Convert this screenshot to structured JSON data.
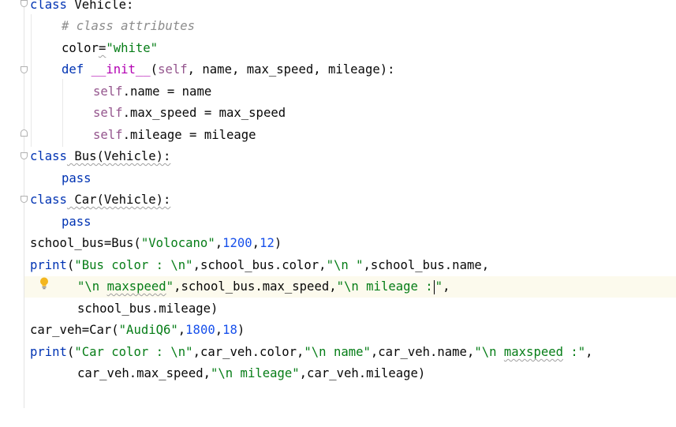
{
  "code": {
    "l1": {
      "kw": "class",
      "rest": " Vehicle:"
    },
    "l2": {
      "comment": "# class attributes"
    },
    "l3": {
      "name": "color",
      "eq": "=",
      "str": "\"white\""
    },
    "l4": {
      "kw": "def",
      "fn": "__init__",
      "open": "(",
      "self": "self",
      "params": ", name, max_speed, mileage",
      "close": "):"
    },
    "l5": {
      "self": "self",
      "rest": ".name = name"
    },
    "l6": {
      "self": "self",
      "rest": ".max_speed = max_speed"
    },
    "l7": {
      "self": "self",
      "rest": ".mileage = mileage"
    },
    "l8": {
      "kw": "class",
      "rest": " Bus(Vehicle):"
    },
    "l9": {
      "kw": "pass"
    },
    "l10": {
      "kw": "class",
      "rest": " Car(Vehicle):"
    },
    "l11": {
      "kw": "pass"
    },
    "l12": {
      "a": "school_bus=Bus(",
      "s1": "\"Volocano\"",
      "c1": ",",
      "n1": "1200",
      "c2": ",",
      "n2": "12",
      "end": ")"
    },
    "l13": {
      "fn": "print",
      "a": "(",
      "s1": "\"Bus color : \\n\"",
      "b": ",school_bus.color,",
      "s2": "\"\\n \"",
      "c": ",school_bus.name,"
    },
    "l14": {
      "s1a": "\"\\n ",
      "s1b": "maxspeed",
      "s1c": "\"",
      "b": ",school_bus.max_speed,",
      "s2a": "\"\\n mileage :",
      "s2b": "\"",
      "c": ","
    },
    "l15": {
      "a": "school_bus.mileage)"
    },
    "l16": {
      "a": "car_veh=Car(",
      "s1": "\"AudiQ6\"",
      "c1": ",",
      "n1": "1800",
      "c2": ",",
      "n2": "18",
      "end": ")"
    },
    "l17": {
      "fn": "print",
      "a": "(",
      "s1": "\"Car color : \\n\"",
      "b": ",car_veh.color,",
      "s2": "\"\\n name\"",
      "c": ",car_veh.name,",
      "s3a": "\"\\n ",
      "s3b": "maxspeed",
      "s3c": " :\"",
      "d": ","
    },
    "l18": {
      "a": "car_veh.max_speed,",
      "s1": "\"\\n mileage\"",
      "b": ",car_veh.mileage)"
    }
  },
  "icons": {
    "intention": "lightbulb-icon",
    "fold": "fold-marker-icon"
  },
  "colors": {
    "keyword": "#0033b3",
    "string": "#067d17",
    "number": "#1750eb",
    "comment": "#8c8c8c",
    "self": "#94558d",
    "dunder": "#b200b2",
    "current_line": "#fcfaed"
  }
}
